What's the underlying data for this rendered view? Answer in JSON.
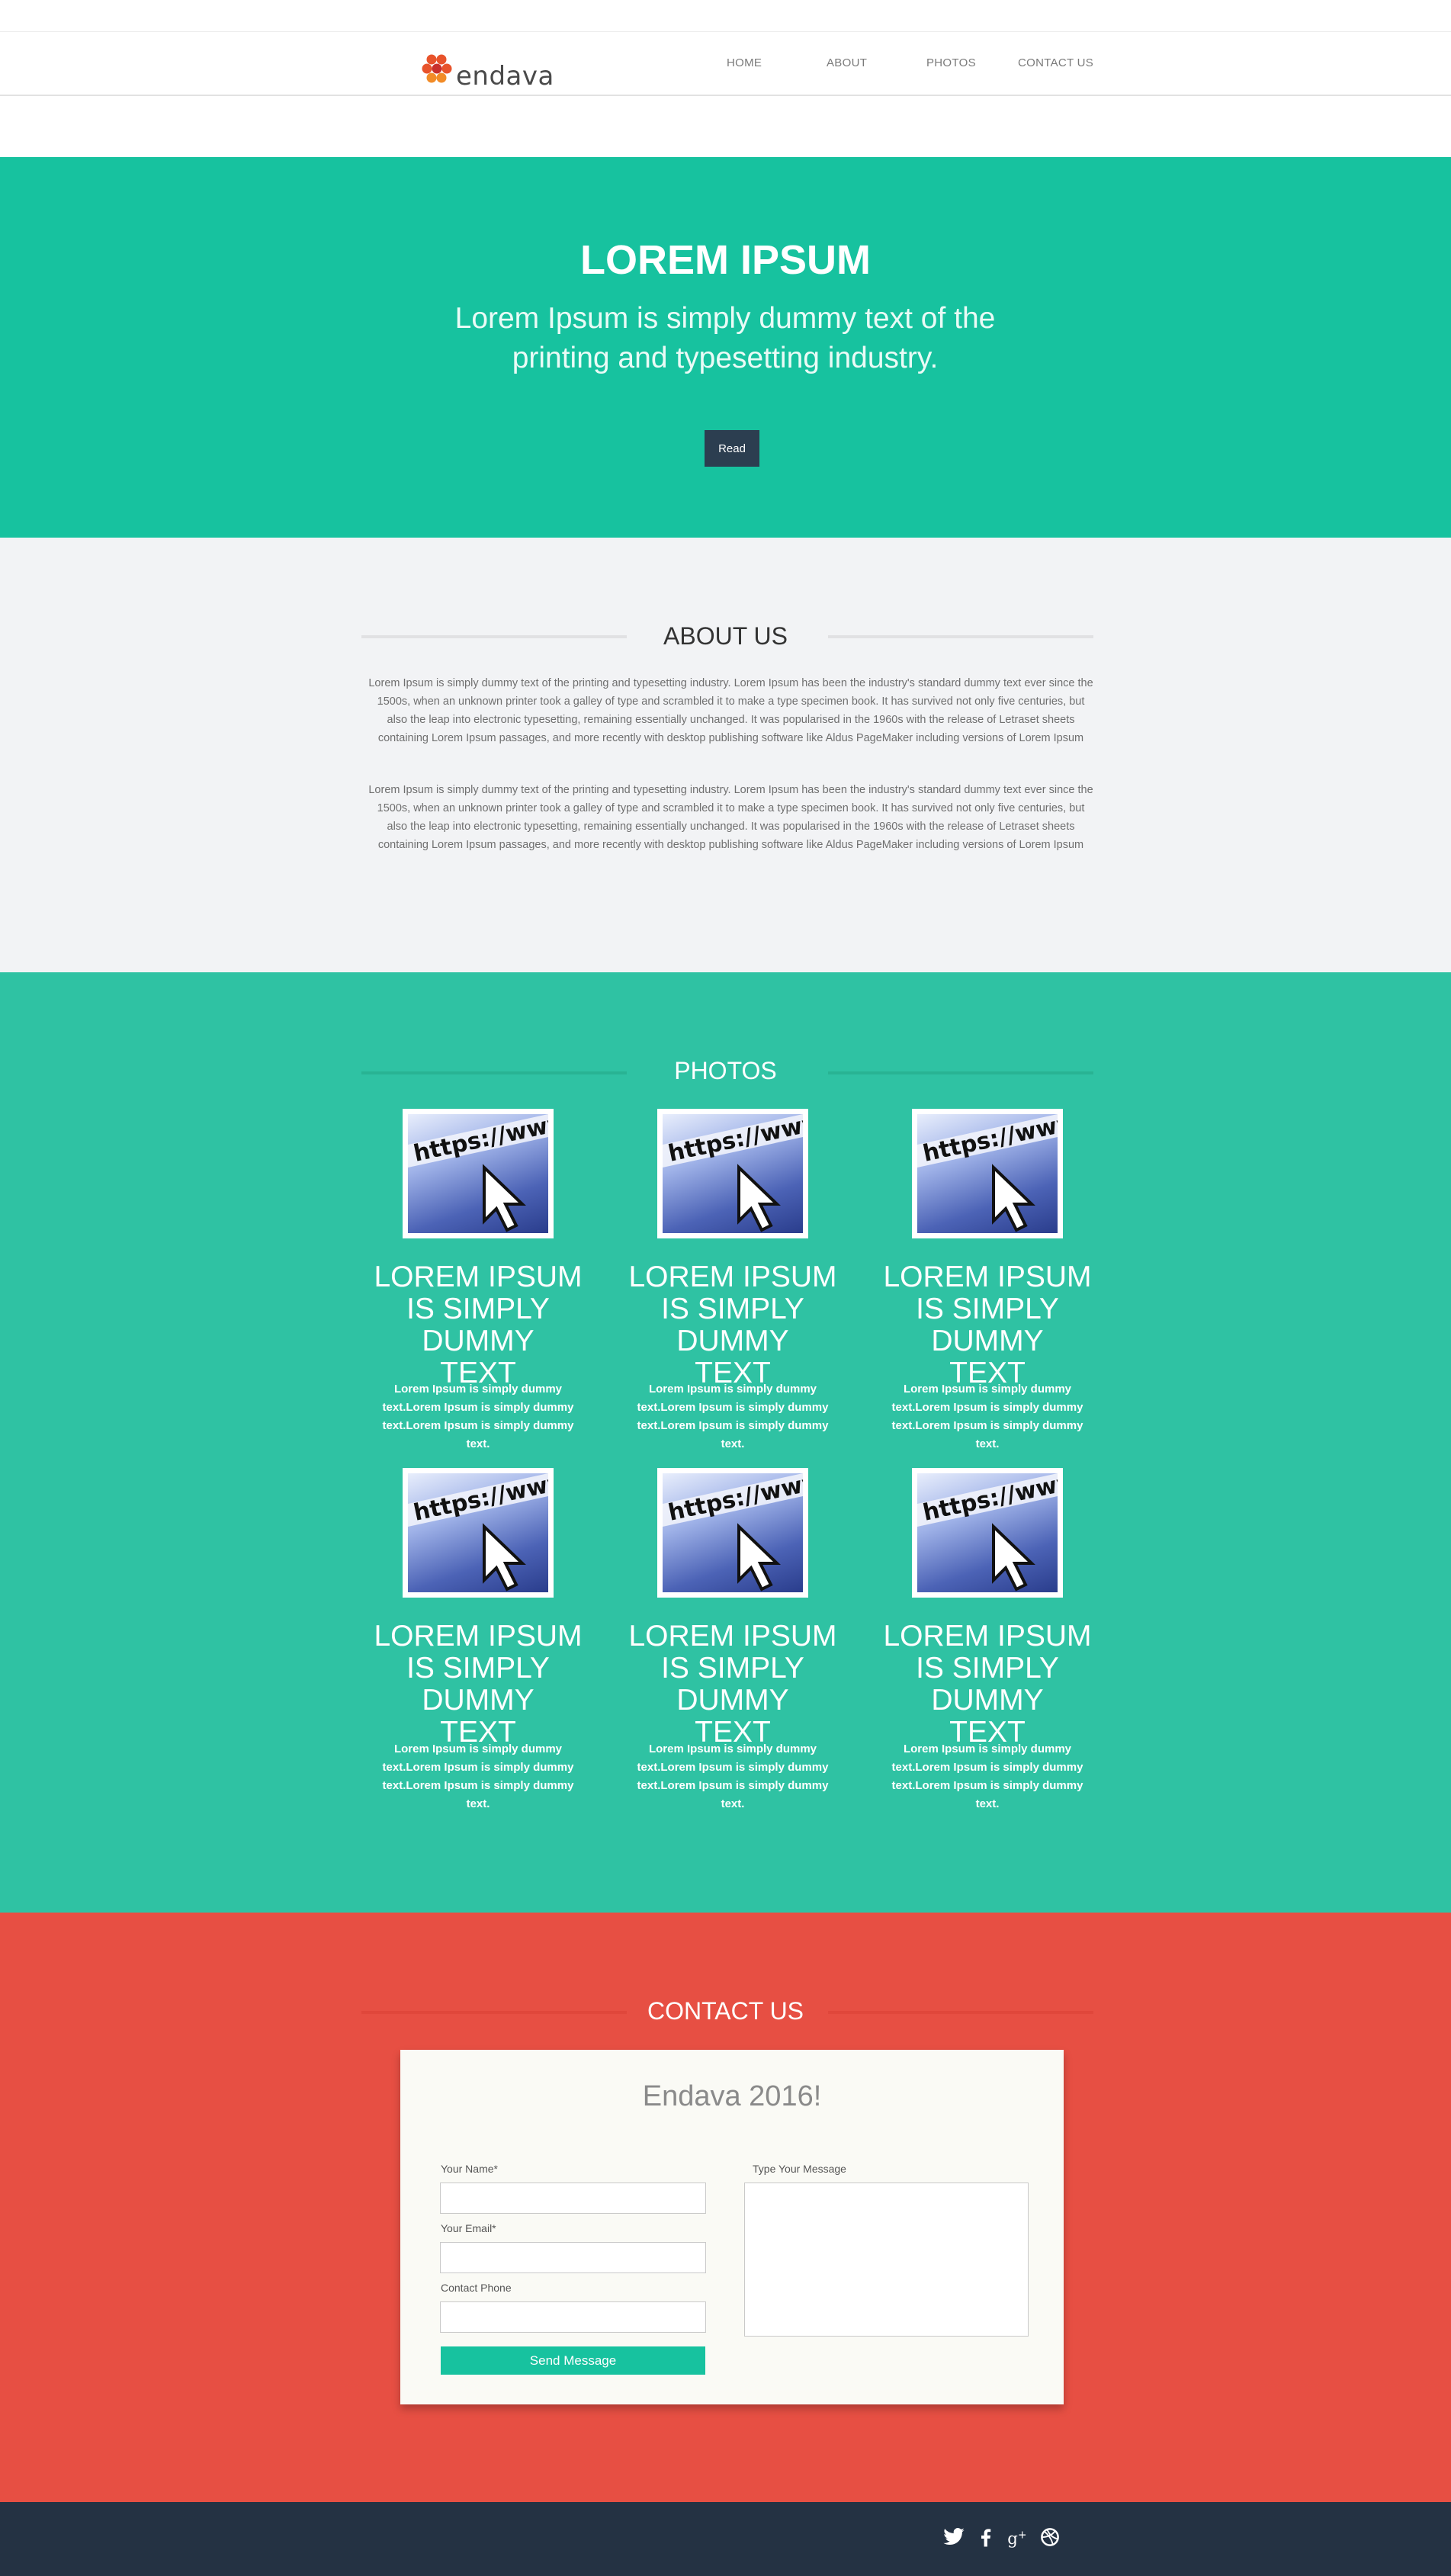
{
  "header": {
    "logo_text": "endava",
    "nav": [
      {
        "label": "HOME"
      },
      {
        "label": "ABOUT"
      },
      {
        "label": "PHOTOS"
      },
      {
        "label": "CONTACT US"
      }
    ]
  },
  "hero": {
    "title": "LOREM IPSUM",
    "subtitle": "Lorem Ipsum is simply dummy text of the printing and typesetting industry.",
    "button_label": "Read"
  },
  "about": {
    "title": "ABOUT US",
    "paragraphs": [
      "Lorem Ipsum is simply dummy text of the printing and typesetting industry. Lorem Ipsum has been the industry's standard dummy text ever since the 1500s, when an unknown printer took a galley of type and scrambled it to make a type specimen book. It has survived not only five centuries, but also the leap into electronic typesetting, remaining essentially unchanged. It was popularised in the 1960s with the release of Letraset sheets containing Lorem Ipsum passages, and more recently with desktop publishing software like Aldus PageMaker including versions of Lorem Ipsum",
      "Lorem Ipsum is simply dummy text of the printing and typesetting industry. Lorem Ipsum has been the industry's standard dummy text ever since the 1500s, when an unknown printer took a galley of type and scrambled it to make a type specimen book. It has survived not only five centuries, but also the leap into electronic typesetting, remaining essentially unchanged. It was popularised in the 1960s with the release of Letraset sheets containing Lorem Ipsum passages, and more recently with desktop publishing software like Aldus PageMaker including versions of Lorem Ipsum"
    ]
  },
  "photos": {
    "title": "PHOTOS",
    "image_text": "https://www",
    "cards": [
      {
        "title_1": "LOREM IPSUM",
        "title_2": "IS SIMPLY DUMMY",
        "title_3": "TEXT",
        "text_1": "Lorem Ipsum is simply dummy",
        "text_2": "text.Lorem Ipsum is simply dummy",
        "text_3": "text.Lorem Ipsum is simply dummy",
        "text_4": "text."
      },
      {
        "title_1": "LOREM IPSUM",
        "title_2": "IS SIMPLY DUMMY",
        "title_3": "TEXT",
        "text_1": "Lorem Ipsum is simply dummy",
        "text_2": "text.Lorem Ipsum is simply dummy",
        "text_3": "text.Lorem Ipsum is simply dummy",
        "text_4": "text."
      },
      {
        "title_1": "LOREM IPSUM",
        "title_2": "IS SIMPLY DUMMY",
        "title_3": "TEXT",
        "text_1": "Lorem Ipsum is simply dummy",
        "text_2": "text.Lorem Ipsum is simply dummy",
        "text_3": "text.Lorem Ipsum is simply dummy",
        "text_4": "text."
      },
      {
        "title_1": "LOREM IPSUM",
        "title_2": "IS SIMPLY DUMMY",
        "title_3": "TEXT",
        "text_1": "Lorem Ipsum is simply dummy",
        "text_2": "text.Lorem Ipsum is simply dummy",
        "text_3": "text.Lorem Ipsum is simply dummy",
        "text_4": "text."
      },
      {
        "title_1": "LOREM IPSUM",
        "title_2": "IS SIMPLY DUMMY",
        "title_3": "TEXT",
        "text_1": "Lorem Ipsum is simply dummy",
        "text_2": "text.Lorem Ipsum is simply dummy",
        "text_3": "text.Lorem Ipsum is simply dummy",
        "text_4": "text."
      },
      {
        "title_1": "LOREM IPSUM",
        "title_2": "IS SIMPLY DUMMY",
        "title_3": "TEXT",
        "text_1": "Lorem Ipsum is simply dummy",
        "text_2": "text.Lorem Ipsum is simply dummy",
        "text_3": "text.Lorem Ipsum is simply dummy",
        "text_4": "text."
      }
    ]
  },
  "contact": {
    "title": "CONTACT US",
    "form_heading": "Endava 2016!",
    "name_label": "Your Name*",
    "email_label": "Your Email*",
    "phone_label": "Contact Phone",
    "message_label": "Type Your Message",
    "name_value": "",
    "email_value": "",
    "phone_value": "",
    "message_value": "",
    "send_label": "Send Message"
  },
  "footer": {
    "social": [
      {
        "icon": "twitter-icon"
      },
      {
        "icon": "facebook-icon"
      },
      {
        "icon": "google-plus-icon"
      },
      {
        "icon": "dribbble-icon"
      }
    ]
  },
  "colors": {
    "hero_bg": "#17c29f",
    "about_bg": "#f2f3f5",
    "photos_bg": "#2fc2a3",
    "contact_bg": "#e74f43",
    "footer_bg": "#243243",
    "button_dark": "#2c3e50",
    "button_green": "#17c29f"
  }
}
